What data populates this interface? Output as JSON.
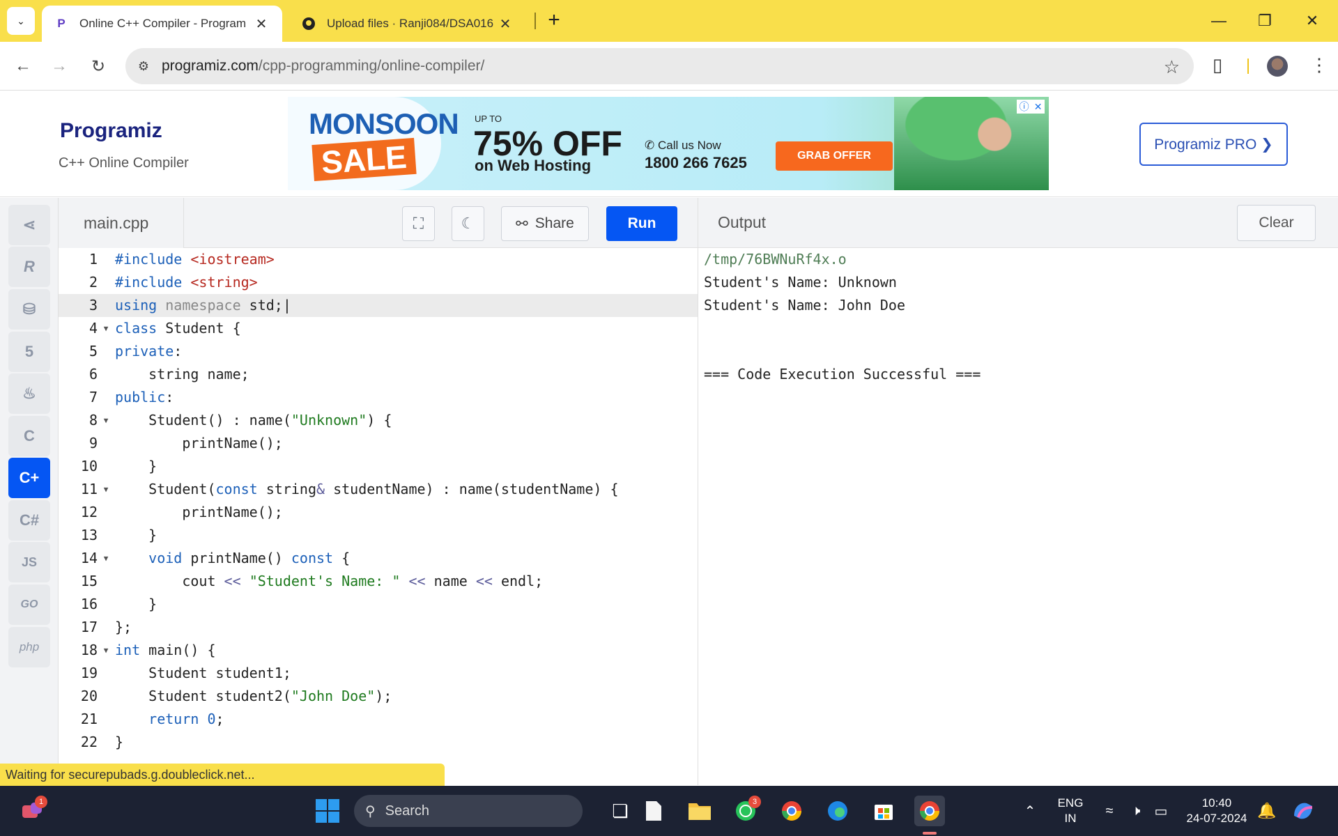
{
  "browser": {
    "tabs": [
      {
        "title": "Online C++ Compiler - Program",
        "favicon": "programiz-icon"
      },
      {
        "title": "Upload files · Ranji084/DSA016",
        "favicon": "github-icon"
      }
    ],
    "url_host": "programiz.com",
    "url_path": "/cpp-programming/online-compiler/",
    "status_text": "Waiting for securepubads.g.doubleclick.net..."
  },
  "site": {
    "logo": "Programiz",
    "subtitle": "C++ Online Compiler",
    "pro_button": "Programiz PRO ❯",
    "ad": {
      "monsoon": "MONSOON",
      "sale": "SALE",
      "upto": "UP TO",
      "offer": "75% OFF",
      "hosting": "on Web Hosting",
      "call": "Call us Now",
      "phone": "1800 266 7625",
      "cta": "GRAB OFFER"
    }
  },
  "rail": {
    "items": [
      "Python",
      "R",
      "SQL",
      "HTML",
      "Java",
      "C",
      "C++",
      "C#",
      "JS",
      "GO",
      "php"
    ],
    "active": "C++"
  },
  "editor": {
    "filename": "main.cpp",
    "share_label": "Share",
    "run_label": "Run",
    "current_line": 3
  },
  "output": {
    "title": "Output",
    "clear_label": "Clear",
    "lines": [
      "/tmp/76BWNuRf4x.o",
      "Student's Name: Unknown",
      "Student's Name: John Doe",
      "",
      "",
      "=== Code Execution Successful ==="
    ]
  },
  "taskbar": {
    "search_label": "Search",
    "lang_top": "ENG",
    "lang_bottom": "IN",
    "time": "10:40",
    "date": "24-07-2024",
    "teams_badge": "1",
    "whatsapp_badge": "3"
  }
}
